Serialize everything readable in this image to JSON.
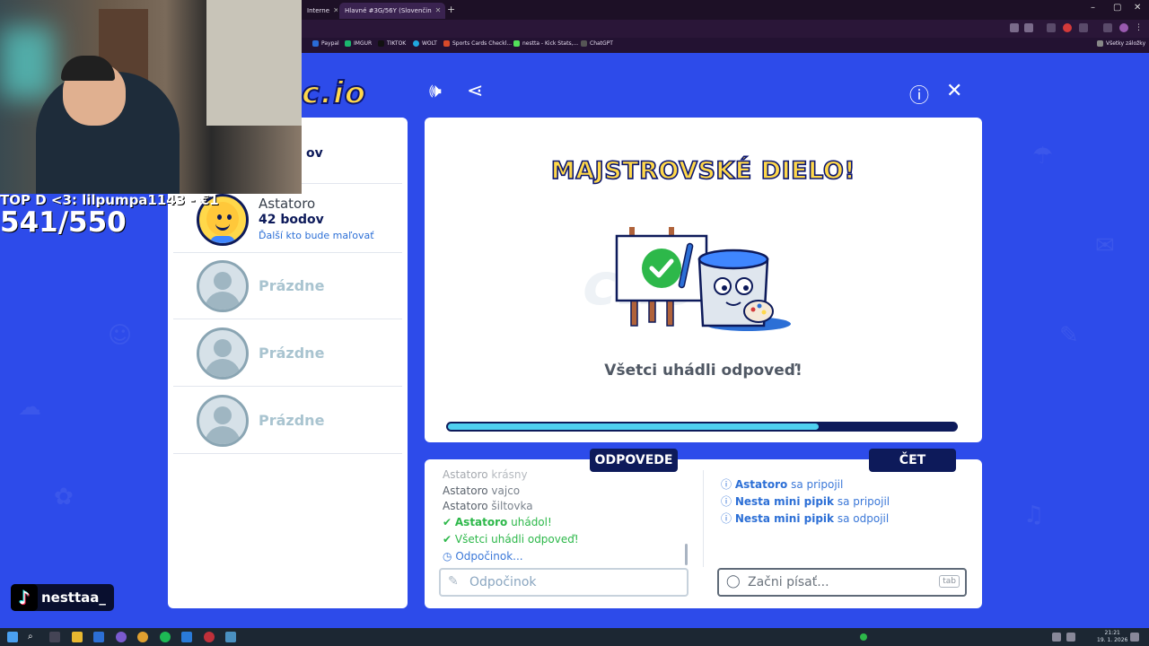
{
  "browser": {
    "tabs": [
      {
        "label": "Interne"
      },
      {
        "label": "Hlavné #3G/56Y (Slovenčin"
      }
    ],
    "bookmarks": [
      "Paypal",
      "IMGUR",
      "TIKTOK",
      "WOLT",
      "Sports Cards Checkl...",
      "nestta - Kick Stats,...",
      "ChatGPT"
    ],
    "bookmarks_other": "Všetky záložky"
  },
  "game": {
    "logo": "c.io",
    "players": [
      {
        "name": "",
        "score": "ov",
        "next": ""
      },
      {
        "name": "Astatoro",
        "score": "42 bodov",
        "next": "Ďalší kto bude maľovať"
      },
      {
        "name": "Prázdne"
      },
      {
        "name": "Prázdne"
      },
      {
        "name": "Prázdne"
      }
    ],
    "stage": {
      "title": "MAJSTROVSKÉ DIELO!",
      "watermark": "c.io",
      "message": "Všetci uhádli odpoveď!",
      "progress": 0.73
    },
    "answers": {
      "tab_label": "ODPOVEDE",
      "lines": [
        {
          "name": "Astatoro",
          "text": "krásny"
        },
        {
          "name": "Astatoro",
          "text": "vajco"
        },
        {
          "name": "Astatoro",
          "text": "šiltovka"
        },
        {
          "name": "Astatoro",
          "text": "uhádol!"
        },
        {
          "name": "",
          "text": "Všetci uhádli odpoveď!"
        },
        {
          "name": "",
          "text": "Odpočinok..."
        }
      ],
      "input_placeholder": "Odpočinok"
    },
    "chat": {
      "tab_label": "ČET",
      "lines": [
        {
          "name": "Astatoro",
          "text": "sa pripojil"
        },
        {
          "name": "Nesta mini pipik",
          "text": "sa pripojil"
        },
        {
          "name": "Nesta mini pipik",
          "text": "sa odpojil"
        }
      ],
      "input_placeholder": "Začni písať...",
      "tab_hint": "tab"
    }
  },
  "stream": {
    "top_donor": "TOP D <3: lilpumpa1143 - €1",
    "counter": "541/550",
    "tiktok_name": "nesttaa_"
  },
  "taskbar": {
    "time": "21:21",
    "date": "19. 1. 2026"
  }
}
